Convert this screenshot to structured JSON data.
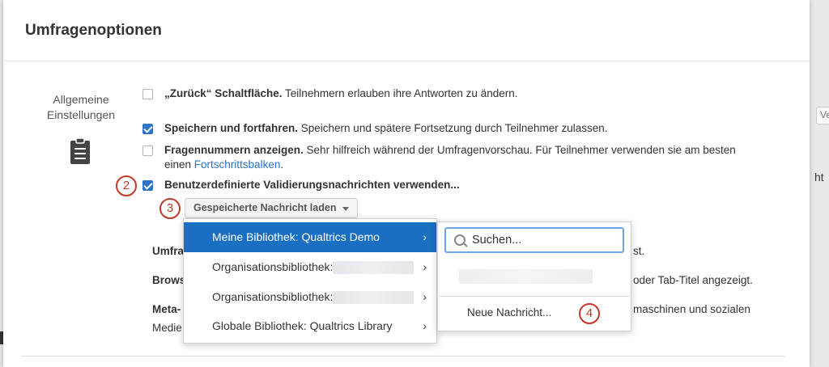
{
  "modal": {
    "title": "Umfragenoptionen"
  },
  "section": {
    "label_line1": "Allgemeine",
    "label_line2": "Einstellungen",
    "icon": "clipboard-icon"
  },
  "options": [
    {
      "checked": false,
      "bold": "„Zurück“ Schaltfläche.",
      "text": " Teilnehmern erlauben ihre Antworten zu ändern."
    },
    {
      "checked": true,
      "bold": "Speichern und fortfahren.",
      "text": " Speichern und spätere Fortsetzung durch Teilnehmer zulassen."
    },
    {
      "checked": false,
      "bold": "Fragennummern anzeigen.",
      "text": " Sehr hilfreich während der Umfragenvorschau. Für Teilnehmer verwenden sie am besten",
      "text2": "einen ",
      "link": "Fortschrittsbalken",
      "text3": "."
    },
    {
      "checked": true,
      "bold": "Benutzerdefinierte Validierungsnachrichten verwenden..."
    }
  ],
  "load_button": {
    "label": "Gespeicherte Nachricht laden"
  },
  "badges": {
    "b2": "2",
    "b3": "3",
    "b4": "4"
  },
  "truncated": {
    "r1_label": "Umfra",
    "r1_tail": "st.",
    "r2_label": "Brows",
    "r2_tail": "oder Tab-Titel angezeigt.",
    "r3_label": "Meta-",
    "r3_tail": "maschinen und sozialen",
    "r4_label": "Medie"
  },
  "library_menu": {
    "items": [
      {
        "label": "Meine Bibliothek: Qualtrics Demo",
        "active": true
      },
      {
        "label": "Organisationsbibliothek:"
      },
      {
        "label": "Organisationsbibliothek:"
      },
      {
        "label": "Globale Bibliothek: Qualtrics Library"
      }
    ],
    "chevron": "›"
  },
  "submenu": {
    "search_value": "Suchen...",
    "new_message": "Neue Nachricht..."
  },
  "background": {
    "right_btn": "Ve",
    "right_text": "ht"
  },
  "colors": {
    "accent": "#1b6fc2",
    "checkbox": "#2b74c7",
    "badge": "#c0392b"
  }
}
